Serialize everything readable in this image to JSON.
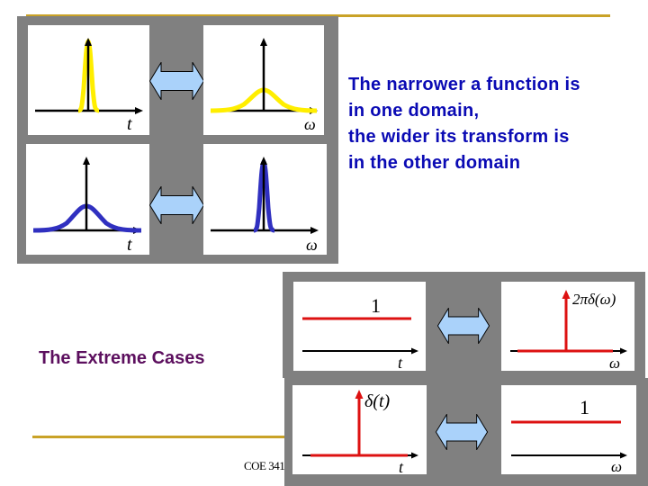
{
  "slide": {
    "caption_lines": [
      "The narrower a function is",
      "in one domain,",
      "the wider its transform is",
      "in the other domain"
    ],
    "subtitle": "The Extreme Cases",
    "footer": "COE 341"
  },
  "gaussian_pairs": {
    "pairs": [
      {
        "time": {
          "shape": "narrow-gaussian",
          "color": "#ffee00",
          "axis_label": "t"
        },
        "freq": {
          "shape": "wide-gaussian",
          "color": "#ffee00",
          "axis_label": "ω"
        }
      },
      {
        "time": {
          "shape": "wide-gaussian",
          "color": "#3030c0",
          "axis_label": "t"
        },
        "freq": {
          "shape": "narrow-gaussian",
          "color": "#3030c0",
          "axis_label": "ω"
        }
      }
    ]
  },
  "extreme_cases": {
    "pairs": [
      {
        "time": {
          "shape": "constant",
          "level_label": "1",
          "axis_label": "t"
        },
        "freq": {
          "shape": "impulse",
          "impulse_label": "2πδ(ω)",
          "axis_label": "ω"
        }
      },
      {
        "time": {
          "shape": "impulse",
          "impulse_label": "δ(t)",
          "axis_label": "t"
        },
        "freq": {
          "shape": "constant",
          "level_label": "1",
          "axis_label": "ω"
        }
      }
    ],
    "signal_color": "#dd1111"
  },
  "arrow_color": "#aad2fa"
}
